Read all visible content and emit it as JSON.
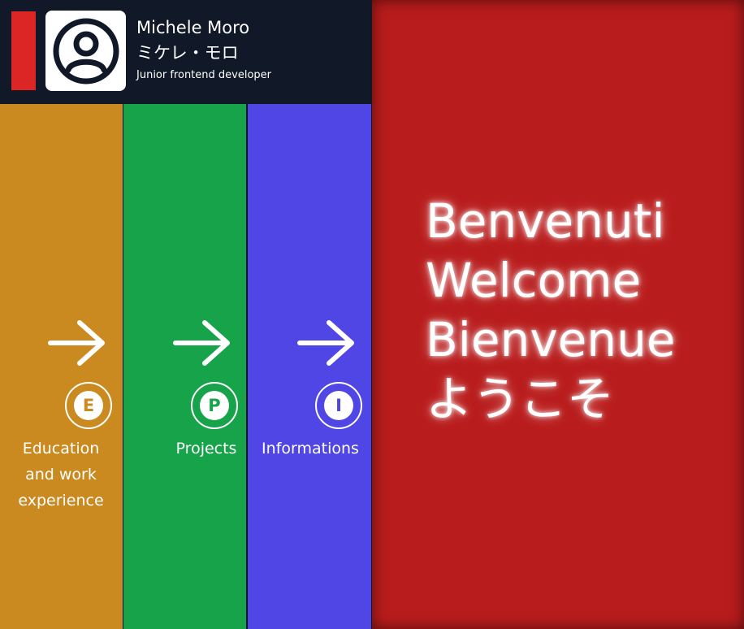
{
  "header": {
    "name": "Michele Moro",
    "name_japanese": "ミケレ・モロ",
    "role": "Junior frontend developer",
    "avatar_icon": "user-circle-icon",
    "accent_color": "#dc2626"
  },
  "sections": [
    {
      "id": "education",
      "letter": "E",
      "label_lines": [
        "Education",
        "and work",
        "experience"
      ],
      "color": "#ca8a20",
      "icon": "arrow-right-icon"
    },
    {
      "id": "projects",
      "letter": "P",
      "label_lines": [
        "Projects"
      ],
      "color": "#16a34a",
      "icon": "arrow-right-icon"
    },
    {
      "id": "informations",
      "letter": "I",
      "label_lines": [
        "Informations"
      ],
      "color": "#4f46e5",
      "icon": "arrow-right-icon"
    }
  ],
  "welcome": {
    "lines": [
      "Benvenuti",
      "Welcome",
      "Bienvenue",
      "ようこそ"
    ],
    "background": "#b91c1c"
  }
}
